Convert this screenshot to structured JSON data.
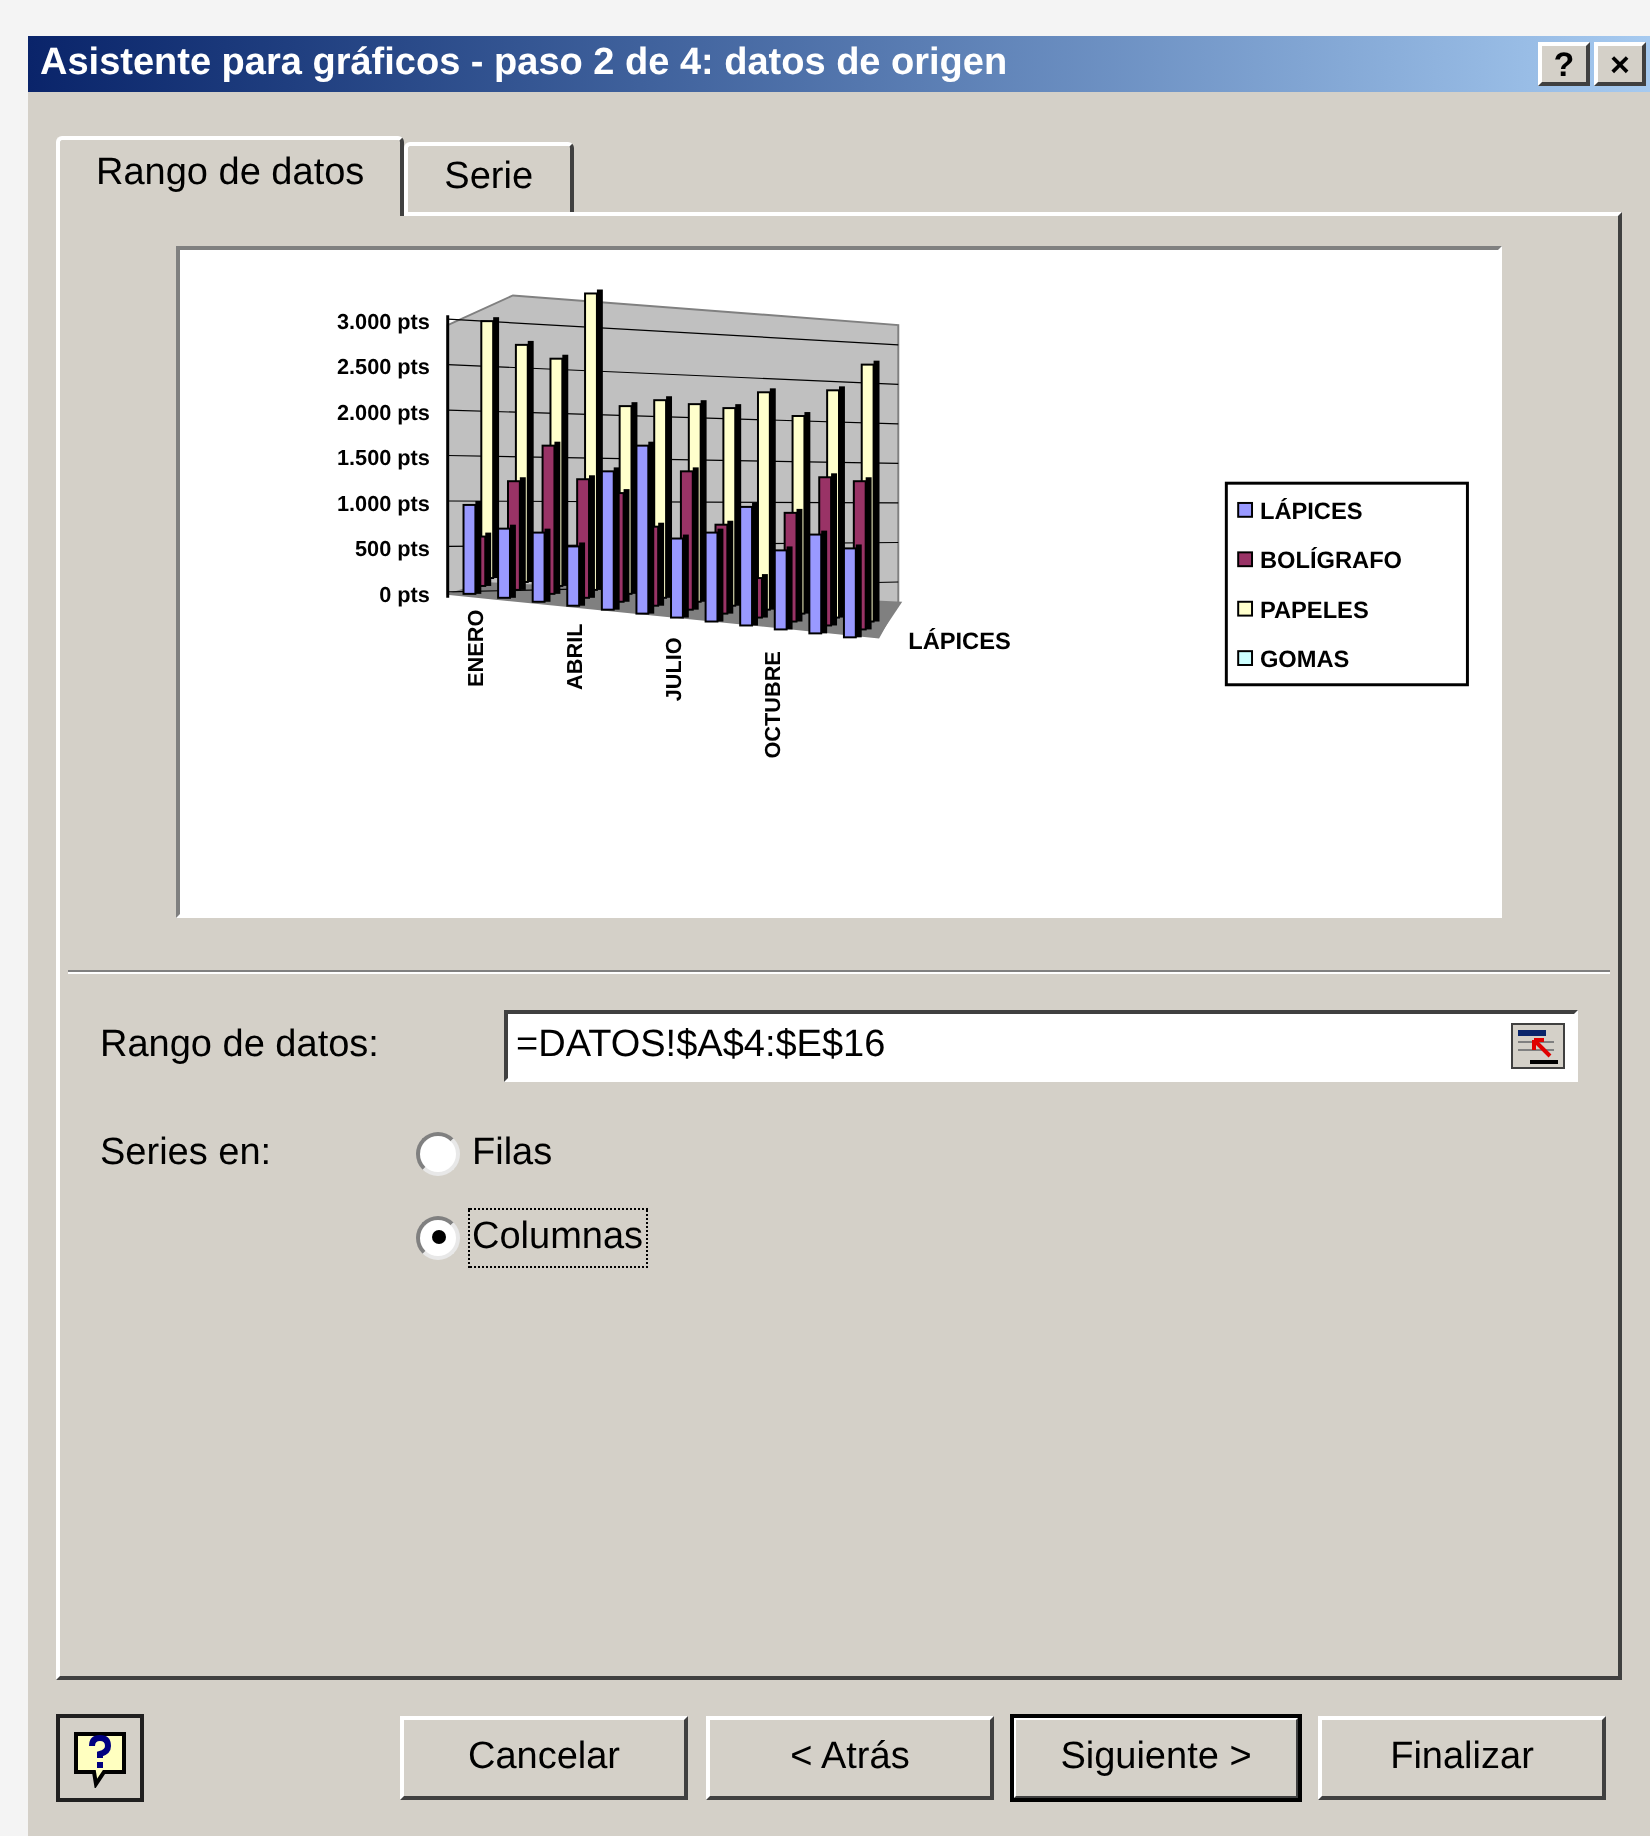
{
  "window": {
    "title": "Asistente para gráficos - paso 2 de 4: datos de origen",
    "title_buttons": [
      "?",
      "×"
    ]
  },
  "tabs": [
    {
      "label": "Rango de datos",
      "selected": true
    },
    {
      "label": "Serie",
      "selected": false
    }
  ],
  "preview": {
    "y_axis_labels": [
      "3.000 pts",
      "2.500 pts",
      "2.000 pts",
      "1.500 pts",
      "1.000 pts",
      "500 pts",
      "0 pts"
    ],
    "category_labels": [
      "ENERO",
      "ABRIL",
      "JULIO",
      "OCTUBRE"
    ],
    "series_axis_label": "LÁPICES",
    "legend": [
      {
        "name": "LÁPICES",
        "color": "#9999ff"
      },
      {
        "name": "BOLÍGRAFO",
        "color": "#993366"
      },
      {
        "name": "PAPELES",
        "color": "#ffffcc"
      },
      {
        "name": "GOMAS",
        "color": "#ccffff"
      }
    ]
  },
  "range": {
    "label": "Rango de datos:",
    "value": "=DATOS!$A$4:$E$16"
  },
  "series_in": {
    "label": "Series en:",
    "options": [
      {
        "label": "Filas",
        "selected": false
      },
      {
        "label": "Columnas",
        "selected": true
      }
    ]
  },
  "buttons": [
    {
      "label": "Cancelar",
      "default": false
    },
    {
      "label": "< Atrás",
      "default": false
    },
    {
      "label": "Siguiente >",
      "default": true
    },
    {
      "label": "Finalizar",
      "default": false
    }
  ]
}
